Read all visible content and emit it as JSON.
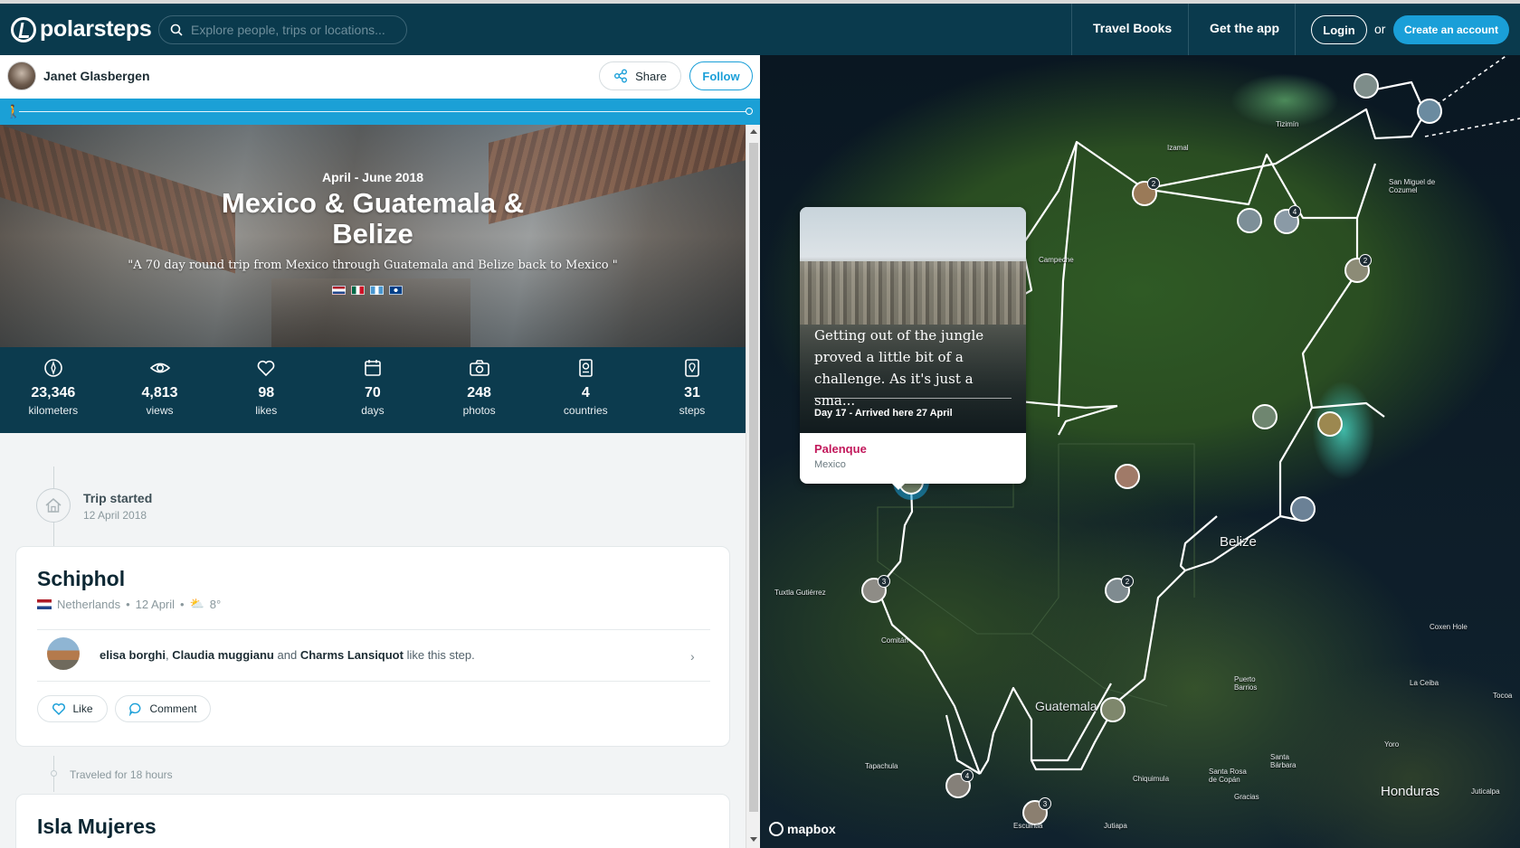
{
  "nav": {
    "brand": "polarsteps",
    "search_placeholder": "Explore people, trips or locations...",
    "travel_books": "Travel Books",
    "get_app": "Get the app",
    "login": "Login",
    "or": "or",
    "create_account": "Create an account"
  },
  "user": {
    "name": "Janet Glasbergen",
    "share": "Share",
    "follow": "Follow"
  },
  "trip": {
    "dates": "April - June 2018",
    "title": "Mexico & Guatemala & Belize",
    "quote": "\"A 70 day round trip from Mexico through Guatemala and Belize back to Mexico \"",
    "stats": [
      {
        "value": "23,346",
        "label": "kilometers",
        "icon": "compass-icon"
      },
      {
        "value": "4,813",
        "label": "views",
        "icon": "eye-icon"
      },
      {
        "value": "98",
        "label": "likes",
        "icon": "heart-icon"
      },
      {
        "value": "70",
        "label": "days",
        "icon": "calendar-icon"
      },
      {
        "value": "248",
        "label": "photos",
        "icon": "camera-icon"
      },
      {
        "value": "4",
        "label": "countries",
        "icon": "passport-icon"
      },
      {
        "value": "31",
        "label": "steps",
        "icon": "location-pin-icon"
      }
    ]
  },
  "timeline": {
    "start_title": "Trip started",
    "start_date": "12 April 2018",
    "traveled": "Traveled for 18 hours"
  },
  "step1": {
    "title": "Schiphol",
    "country": "Netherlands",
    "date": "12 April",
    "temp": "8°",
    "liker1": "elisa borghi",
    "liker2": "Claudia muggianu",
    "and": "and",
    "liker3": "Charms Lansiquot",
    "likes_suffix": "like this step.",
    "like": "Like",
    "comment": "Comment"
  },
  "step2": {
    "title": "Isla Mujeres"
  },
  "popup": {
    "excerpt": "Getting out of the jungle proved a little bit of a challenge. As it's just a sma...",
    "day": "Day 17 - Arrived here 27 April",
    "place": "Palenque",
    "country": "Mexico"
  },
  "map": {
    "labels": {
      "belize": "Belize",
      "guatemala": "Guatemala",
      "honduras": "Honduras",
      "tizimin": "Tizimín",
      "izamal": "Izamal",
      "campeche": "Campeche",
      "san_miguel": "San Miguel de Cozumel",
      "tuxtla": "Tuxtla Gutiérrez",
      "comitan": "Comitán",
      "tapachula": "Tapachula",
      "escuintla": "Escuintla",
      "jutiapa": "Jutiapa",
      "chiquimula": "Chiquimula",
      "santa_rosa": "Santa Rosa de Copán",
      "gracias": "Gracias",
      "santa_barbara": "Santa Bárbara",
      "yoro": "Yoro",
      "juticalpa": "Juticalpa",
      "la_ceiba": "La Ceiba",
      "tocoa": "Tocoa",
      "puerto_barrios": "Puerto Barrios",
      "coxen_hole": "Coxen Hole"
    },
    "attribution": "mapbox",
    "cluster_counts": [
      "2",
      "4",
      "2",
      "3",
      "2",
      "3",
      "4"
    ]
  },
  "colors": {
    "nav_bg": "#0a3a4d",
    "accent": "#1a9fd8",
    "place_pink": "#c2185b"
  }
}
